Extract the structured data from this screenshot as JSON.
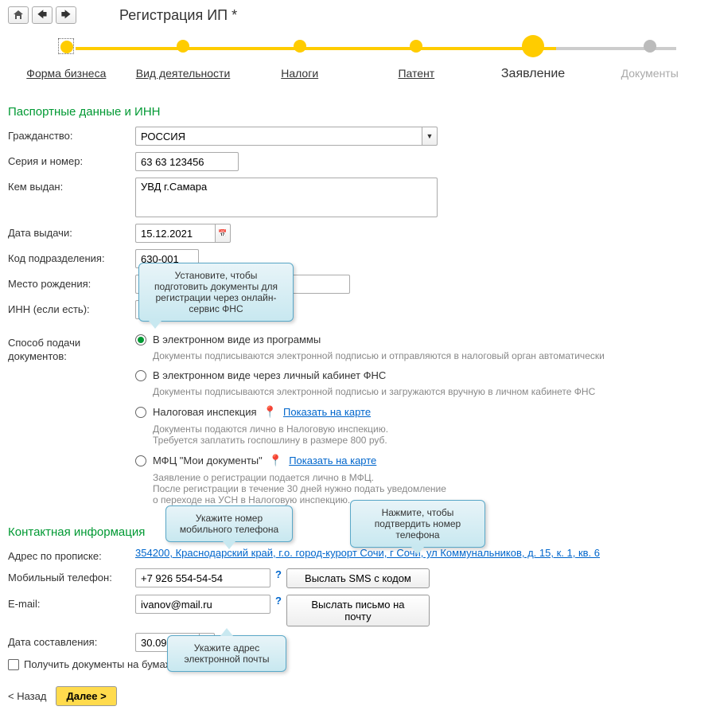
{
  "title": "Регистрация ИП *",
  "wizard": {
    "steps": [
      {
        "label": "Форма бизнеса"
      },
      {
        "label": "Вид деятельности"
      },
      {
        "label": "Налоги"
      },
      {
        "label": "Патент"
      },
      {
        "label": "Заявление"
      },
      {
        "label": "Документы"
      }
    ]
  },
  "section_passport": "Паспортные данные и ИНН",
  "citizenship": {
    "label": "Гражданство:",
    "value": "РОССИЯ"
  },
  "series": {
    "label": "Серия и номер:",
    "value": "63 63 123456"
  },
  "issued_by": {
    "label": "Кем выдан:",
    "value": "УВД г.Самара"
  },
  "issue_date": {
    "label": "Дата выдачи:",
    "value": "15.12.2021"
  },
  "issue_code": {
    "label": "Код подразделения:",
    "value": "630-001"
  },
  "birthplace": {
    "label": "Место рождения:",
    "value": ""
  },
  "inn": {
    "label": "ИНН (если есть):",
    "value": ""
  },
  "submission": {
    "label": "Способ подачи документов:",
    "opt1": "В электронном виде из программы",
    "hint1": "Документы подписываются электронной подписью и отправляются в налоговый орган автоматически",
    "opt2": "В электронном виде через личный кабинет ФНС",
    "hint2": "Документы подписываются электронной подписью и загружаются вручную в личном кабинете ФНС",
    "opt3": "Налоговая инспекция",
    "map_link": "Показать на карте",
    "hint3": "Документы подаются лично в Налоговую инспекцию.\nТребуется заплатить госпошлину в размере 800 руб.",
    "opt4": "МФЦ \"Мои документы\"",
    "hint4": "Заявление о регистрации подается лично в МФЦ.\nПосле регистрации в течение 30 дней нужно подать уведомление\nо переходе на УСН в Налоговую инспекцию."
  },
  "section_contact": "Контактная информация",
  "address": {
    "label": "Адрес по прописке:",
    "value": "354200, Краснодарский край, г.о. город-курорт Сочи, г Сочи, ул Коммунальников, д. 15, к. 1, кв. 6"
  },
  "phone": {
    "label": "Мобильный телефон:",
    "value": "+7 926 554-54-54",
    "sms_btn": "Выслать SMS с кодом"
  },
  "email": {
    "label": "E-mail:",
    "value": "ivanov@mail.ru",
    "email_btn": "Выслать письмо на почту"
  },
  "compose_date": {
    "label": "Дата составления:",
    "value": "30.09.2022"
  },
  "paper_docs": "Получить документы на бумажном носителе",
  "btn_back": "< Назад",
  "btn_next": "Далее >",
  "tip1": "Установите, чтобы подготовить документы для регистрации через онлайн-сервис ФНС",
  "tip2": "Укажите номер мобильного телефона",
  "tip3": "Нажмите, чтобы подтвердить номер телефона",
  "tip4": "Укажите адрес электронной почты"
}
